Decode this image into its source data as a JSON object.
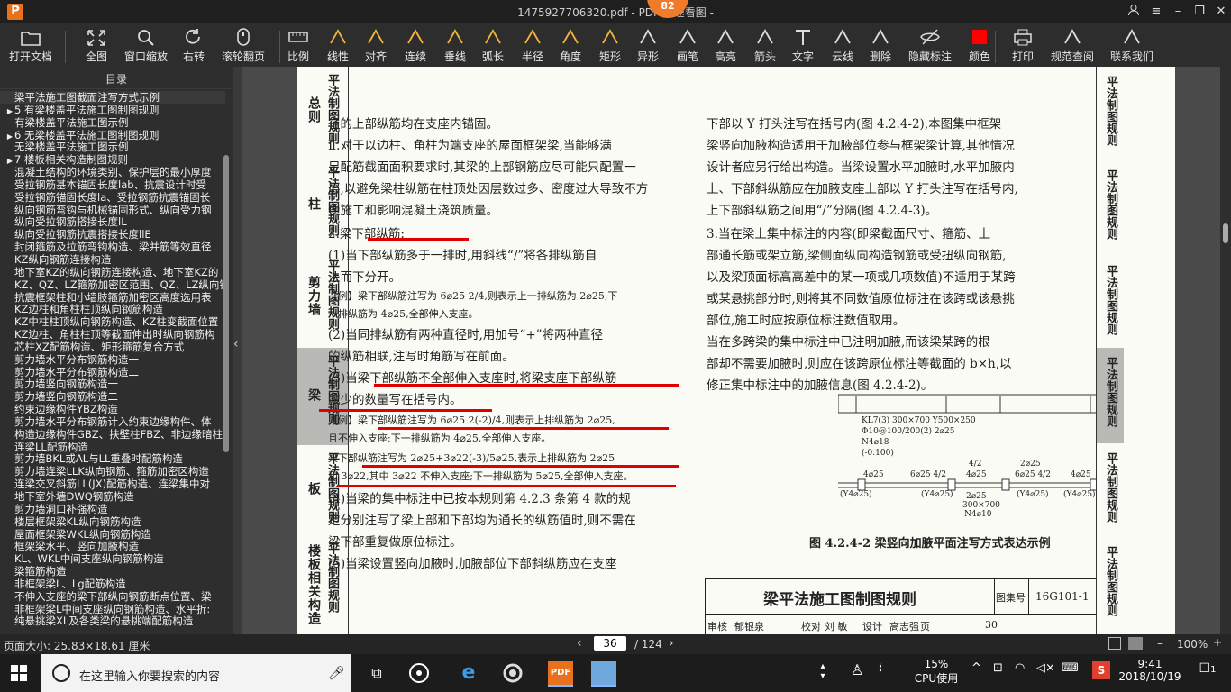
{
  "window": {
    "title": "1475927706320.pdf - PDF 快速看图 -",
    "badge": "82",
    "app_icon": "P"
  },
  "toolbar": [
    {
      "id": "open",
      "label": "打开文档",
      "icon": "folder-icon"
    },
    {
      "id": "fit",
      "label": "全图",
      "icon": "expand-icon"
    },
    {
      "id": "zoom",
      "label": "窗口缩放",
      "icon": "magnifier-icon"
    },
    {
      "id": "rotate",
      "label": "右转",
      "icon": "rotate-icon"
    },
    {
      "id": "scroll",
      "label": "滚轮翻页",
      "icon": "mouse-icon"
    },
    {
      "id": "scale",
      "label": "比例",
      "icon": "ruler-icon"
    },
    {
      "id": "linear",
      "label": "线性",
      "icon": "linear-dim-icon"
    },
    {
      "id": "align",
      "label": "对齐",
      "icon": "aligned-dim-icon"
    },
    {
      "id": "continuous",
      "label": "连续",
      "icon": "continuous-dim-icon"
    },
    {
      "id": "perp",
      "label": "垂线",
      "icon": "perpendicular-icon"
    },
    {
      "id": "arc",
      "label": "弧长",
      "icon": "arc-length-icon"
    },
    {
      "id": "radius",
      "label": "半径",
      "icon": "radius-icon"
    },
    {
      "id": "angle",
      "label": "角度",
      "icon": "angle-icon"
    },
    {
      "id": "rect",
      "label": "矩形",
      "icon": "rectangle-area-icon"
    },
    {
      "id": "irregular",
      "label": "异形",
      "icon": "irregular-area-icon"
    },
    {
      "id": "pen",
      "label": "画笔",
      "icon": "pen-icon"
    },
    {
      "id": "highlight",
      "label": "高亮",
      "icon": "highlighter-icon"
    },
    {
      "id": "arrow",
      "label": "箭头",
      "icon": "arrow-icon"
    },
    {
      "id": "text",
      "label": "文字",
      "icon": "text-icon"
    },
    {
      "id": "cloud",
      "label": "云线",
      "icon": "cloud-line-icon"
    },
    {
      "id": "erase",
      "label": "删除",
      "icon": "eraser-icon"
    },
    {
      "id": "hide",
      "label": "隐藏标注",
      "icon": "eye-hidden-icon"
    },
    {
      "id": "color",
      "label": "颜色",
      "icon": "color-swatch-icon",
      "value": "#ff0000"
    },
    {
      "id": "print",
      "label": "打印",
      "icon": "printer-icon"
    },
    {
      "id": "norm",
      "label": "规范查阅",
      "icon": "book-icon"
    },
    {
      "id": "contact",
      "label": "联系我们",
      "icon": "contact-icon"
    }
  ],
  "sidebar": {
    "header": "目录",
    "items": [
      {
        "t": "梁平法施工图截面注写方式示例",
        "a": ""
      },
      {
        "t": "5 有梁楼盖平法施工图制图规则",
        "a": "▶"
      },
      {
        "t": "有梁楼盖平法施工图示例",
        "a": ""
      },
      {
        "t": "6 无梁楼盖平法施工图制图规则",
        "a": "▶"
      },
      {
        "t": "无梁楼盖平法施工图示例",
        "a": ""
      },
      {
        "t": "7 楼板相关构造制图规则",
        "a": "▶"
      },
      {
        "t": "混凝土结构的环境类别、保护层的最小厚度",
        "a": ""
      },
      {
        "t": "受拉钢筋基本锚固长度lab、抗震设计时受",
        "a": ""
      },
      {
        "t": "受拉钢筋锚固长度la、受拉钢筋抗震锚固长",
        "a": ""
      },
      {
        "t": "纵向钢筋弯钩与机械锚固形式、纵向受力钢",
        "a": ""
      },
      {
        "t": "纵向受拉钢筋搭接长度lL",
        "a": ""
      },
      {
        "t": "纵向受拉钢筋抗震搭接长度llE",
        "a": ""
      },
      {
        "t": "封闭箍筋及拉筋弯钩构造、梁并筋等效直径",
        "a": ""
      },
      {
        "t": "KZ纵向钢筋连接构造",
        "a": ""
      },
      {
        "t": "地下室KZ的纵向钢筋连接构造、地下室KZ的",
        "a": ""
      },
      {
        "t": "KZ、QZ、LZ箍筋加密区范围、QZ、LZ纵向钢",
        "a": ""
      },
      {
        "t": "抗震框架柱和小墙肢箍筋加密区高度选用表",
        "a": ""
      },
      {
        "t": "KZ边柱和角柱柱顶纵向钢筋构造",
        "a": ""
      },
      {
        "t": "KZ中柱柱顶纵向钢筋构造、KZ柱变截面位置",
        "a": ""
      },
      {
        "t": "KZ边柱、角柱柱顶等截面伸出时纵向钢筋构",
        "a": ""
      },
      {
        "t": "芯柱XZ配筋构造、矩形箍筋复合方式",
        "a": ""
      },
      {
        "t": "剪力墙水平分布钢筋构造一",
        "a": ""
      },
      {
        "t": "剪力墙水平分布钢筋构造二",
        "a": ""
      },
      {
        "t": "剪力墙竖向钢筋构造一",
        "a": ""
      },
      {
        "t": "剪力墙竖向钢筋构造二",
        "a": ""
      },
      {
        "t": "约束边缘构件YBZ构造",
        "a": ""
      },
      {
        "t": "剪力墙水平分布钢筋计入约束边缘构件、体",
        "a": ""
      },
      {
        "t": "构造边缘构件GBZ、扶壁柱FBZ、非边缘暗柱",
        "a": ""
      },
      {
        "t": "连梁LL配筋构造",
        "a": ""
      },
      {
        "t": "剪力墙BKL或AL与LL重叠时配筋构造",
        "a": ""
      },
      {
        "t": "剪力墙连梁LLK纵向钢筋、箍筋加密区构造",
        "a": ""
      },
      {
        "t": "连梁交叉斜筋LL(JX)配筋构造、连梁集中对",
        "a": ""
      },
      {
        "t": "地下室外墙DWQ钢筋构造",
        "a": ""
      },
      {
        "t": "剪力墙洞口补强构造",
        "a": ""
      },
      {
        "t": "楼层框架梁KL纵向钢筋构造",
        "a": ""
      },
      {
        "t": "屋面框架梁WKL纵向钢筋构造",
        "a": ""
      },
      {
        "t": "框架梁水平、竖向加腋构造",
        "a": ""
      },
      {
        "t": "KL、WKL中间支座纵向钢筋构造",
        "a": ""
      },
      {
        "t": "梁箍筋构造",
        "a": ""
      },
      {
        "t": "非框架梁L、Lg配筋构造",
        "a": ""
      },
      {
        "t": "不伸入支座的梁下部纵向钢筋断点位置、梁",
        "a": ""
      },
      {
        "t": "非框架梁L中间支座纵向钢筋构造、水平折:",
        "a": ""
      },
      {
        "t": "纯悬挑梁XL及各类梁的悬挑端配筋构造",
        "a": ""
      }
    ]
  },
  "left_tabs": [
    {
      "big": "总则",
      "small": "平法制图规则",
      "sel": false
    },
    {
      "big": "柱",
      "small": "平法制图规则",
      "sel": false
    },
    {
      "big": "剪力墙",
      "small": "平法制图规则",
      "sel": false
    },
    {
      "big": "梁",
      "small": "平法制图规则",
      "sel": true
    },
    {
      "big": "板",
      "small": "平法制图规则",
      "sel": false
    },
    {
      "big": "楼板相关构造",
      "small": "平法制图规则",
      "sel": false
    }
  ],
  "right_tabs": [
    {
      "t": "平法制图规则",
      "sel": false
    },
    {
      "t": "平法制图规则",
      "sel": false
    },
    {
      "t": "平法制图规则",
      "sel": false
    },
    {
      "t": "平法制图规则",
      "sel": true
    },
    {
      "t": "平法制图规则",
      "sel": false
    },
    {
      "t": "平法制图规则",
      "sel": false
    }
  ],
  "doc": {
    "left_col": [
      {
        "t": "径的上部纵筋均在支座内锚固。",
        "s": false
      },
      {
        "t": "    Ⅱ.对于以边柱、角柱为端支座的屋面框架梁,当能够满",
        "s": false
      },
      {
        "t": "足配筋截面面积要求时,其梁的上部钢筋应尽可能只配置一",
        "s": false
      },
      {
        "t": "层,以避免梁柱纵筋在柱顶处因层数过多、密度过大导致不方",
        "s": false
      },
      {
        "t": "便施工和影响混凝土浇筑质量。",
        "s": false
      },
      {
        "t": "    2.梁下部纵筋:",
        "s": false
      },
      {
        "t": "    (1)当下部纵筋多于一排时,用斜线“/”将各排纵筋自",
        "s": false
      },
      {
        "t": "上而下分开。",
        "s": false
      },
      {
        "t": "    【例】梁下部纵筋注写为 6⌀25 2/4,则表示上一排纵筋为 2⌀25,下",
        "s": true
      },
      {
        "t": "一排纵筋为 4⌀25,全部伸入支座。",
        "s": true
      },
      {
        "t": "    (2)当同排纵筋有两种直径时,用加号“+”将两种直径",
        "s": false
      },
      {
        "t": "的纵筋相联,注写时角筋写在前面。",
        "s": false
      },
      {
        "t": "    (3)当梁下部纵筋不全部伸入支座时,将梁支座下部纵筋",
        "s": false
      },
      {
        "t": "减少的数量写在括号内。",
        "s": false
      },
      {
        "t": "    【例】梁下部纵筋注写为 6⌀25 2(-2)/4,则表示上排纵筋为 2⌀25,",
        "s": true
      },
      {
        "t": "且不伸入支座;下一排纵筋为 4⌀25,全部伸入支座。",
        "s": true
      },
      {
        "t": "    梁下部纵筋注写为 2⌀25+3⌀22(-3)/5⌀25,表示上排纵筋为 2⌀25",
        "s": true
      },
      {
        "t": "和 3⌀22,其中 3⌀22 不伸入支座;下一排纵筋为 5⌀25,全部伸入支座。",
        "s": true
      },
      {
        "t": "    (4)当梁的集中标注中已按本规则第 4.2.3 条第 4 款的规",
        "s": false
      },
      {
        "t": "定分别注写了梁上部和下部均为通长的纵筋值时,则不需在",
        "s": false
      },
      {
        "t": "梁下部重复做原位标注。",
        "s": false
      },
      {
        "t": "    (5)当梁设置竖向加腋时,加腋部位下部斜纵筋应在支座",
        "s": false
      }
    ],
    "right_col": [
      "下部以 Y 打头注写在括号内(图 4.2.4-2),本图集中框架",
      "梁竖向加腋构造适用于加腋部位参与框架梁计算,其他情况",
      "设计者应另行给出构造。当梁设置水平加腋时,水平加腋内",
      "上、下部斜纵筋应在加腋支座上部以 Y 打头注写在括号内,",
      "上下部斜纵筋之间用“/”分隔(图 4.2.4-3)。",
      "    3.当在梁上集中标注的内容(即梁截面尺寸、箍筋、上",
      "部通长筋或架立筋,梁侧面纵向构造钢筋或受扭纵向钢筋,",
      "以及梁顶面标高高差中的某一项或几项数值)不适用于某跨",
      "或某悬挑部分时,则将其不同数值原位标注在该跨或该悬挑",
      "部位,施工时应按原位标注数值取用。",
      "    当在多跨梁的集中标注中已注明加腋,而该梁某跨的根",
      "部却不需要加腋时,则应在该跨原位标注等截面的 b×h,以",
      "修正集中标注中的加腋信息(图 4.2.4-2)。"
    ],
    "figure": {
      "lines": [
        "KL7(3) 300×700 Y500×250",
        "Φ10@100/200(2) 2⌀25",
        "N4⌀18",
        "(-0.100)"
      ],
      "labels": [
        "4⌀25",
        "6⌀25 4/2",
        "4⌀25",
        "6⌀25 4/2",
        "4⌀25",
        "2⌀25",
        "4/2",
        "(Y4⌀25)",
        "(Y4⌀25)",
        "(Y4⌀25)",
        "(Y4⌀25)",
        "300×700",
        "N4⌀10",
        "2⌀25"
      ],
      "caption": "图 4.2.4-2  梁竖向加腋平面注写方式表达示例"
    },
    "titleblock": {
      "title": "梁平法施工图制图规则",
      "atlas_label": "图集号",
      "atlas_no": "16G101-1",
      "row": [
        "审核",
        "郁银泉",
        "校对",
        "刘  敏",
        "设计",
        "高志强",
        "页",
        "30"
      ]
    }
  },
  "status": {
    "page_size": "页面大小: 25.83×18.61 厘米",
    "current_page": "36",
    "total_pages": "/ 124",
    "zoom": "100%"
  },
  "taskbar": {
    "search_placeholder": "在这里输入你要搜索的内容",
    "cpu_percent": "15%",
    "cpu_label": "CPU使用",
    "time": "9:41",
    "date": "2018/10/19",
    "notification_count": "1"
  }
}
